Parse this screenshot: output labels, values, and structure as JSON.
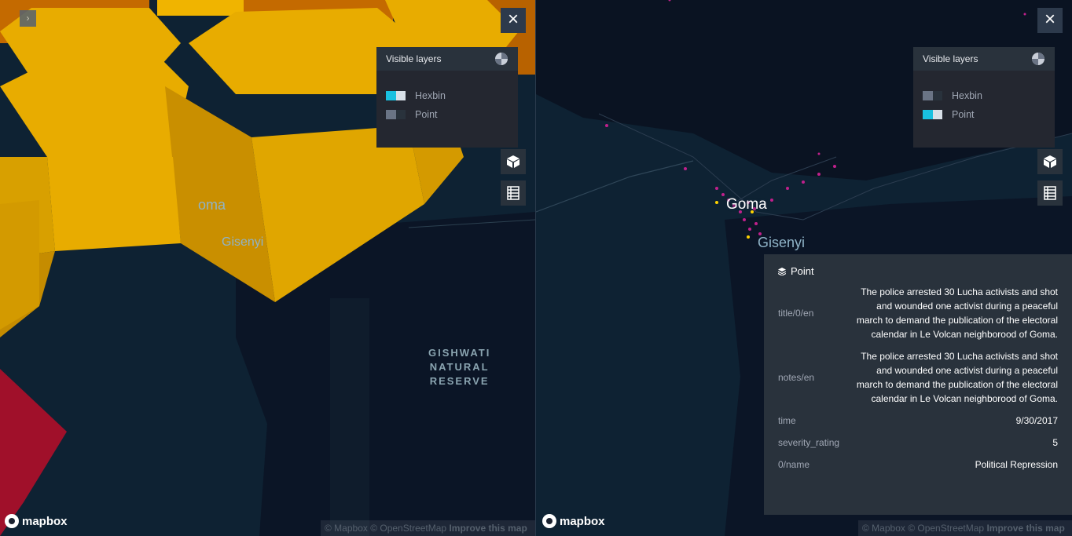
{
  "left_map": {
    "place_labels": {
      "goma": "oma",
      "gisenyi": "Gisenyi"
    },
    "reserve_label": [
      "GISHWATI",
      "NATURAL",
      "RESERVE"
    ],
    "layer_panel": {
      "title": "Visible layers",
      "layers": [
        {
          "label": "Hexbin",
          "visible": true,
          "colors": [
            "#19c0e0",
            "#d8e0e8"
          ]
        },
        {
          "label": "Point",
          "visible": false,
          "colors": [
            "#6a7485",
            "#29323c"
          ]
        }
      ]
    },
    "close_label": "×"
  },
  "right_map": {
    "place_labels": {
      "goma": "Goma",
      "gisenyi": "Gisenyi"
    },
    "layer_panel": {
      "title": "Visible layers",
      "layers": [
        {
          "label": "Hexbin",
          "visible": false,
          "colors": [
            "#6a7485",
            "#29323c"
          ]
        },
        {
          "label": "Point",
          "visible": true,
          "colors": [
            "#19c0e0",
            "#d8e0e8"
          ]
        }
      ]
    },
    "close_label": "×",
    "tooltip": {
      "layer_name": "Point",
      "fields": [
        {
          "key": "title/0/en",
          "value": "The police arrested 30 Lucha activists and shot and wounded one activist during a peaceful march to demand the publication of the electoral calendar in Le Volcan neighborood of Goma."
        },
        {
          "key": "notes/en",
          "value": "The police arrested 30 Lucha activists and shot and wounded one activist during a peaceful march to demand the publication of the electoral calendar in Le Volcan neighborood of Goma."
        },
        {
          "key": "time",
          "value": "9/30/2017"
        },
        {
          "key": "severity_rating",
          "value": "5"
        },
        {
          "key": "0/name",
          "value": "Political Repression"
        }
      ]
    }
  },
  "footer": {
    "logo_text": "mapbox",
    "attribution": "© Mapbox © OpenStreetMap",
    "improve": "Improve this map"
  },
  "colors": {
    "hex_yellow": "#e8ac00",
    "hex_red": "#a0102a",
    "hex_orange": "#d77a00",
    "accent": "#19c0e0"
  }
}
